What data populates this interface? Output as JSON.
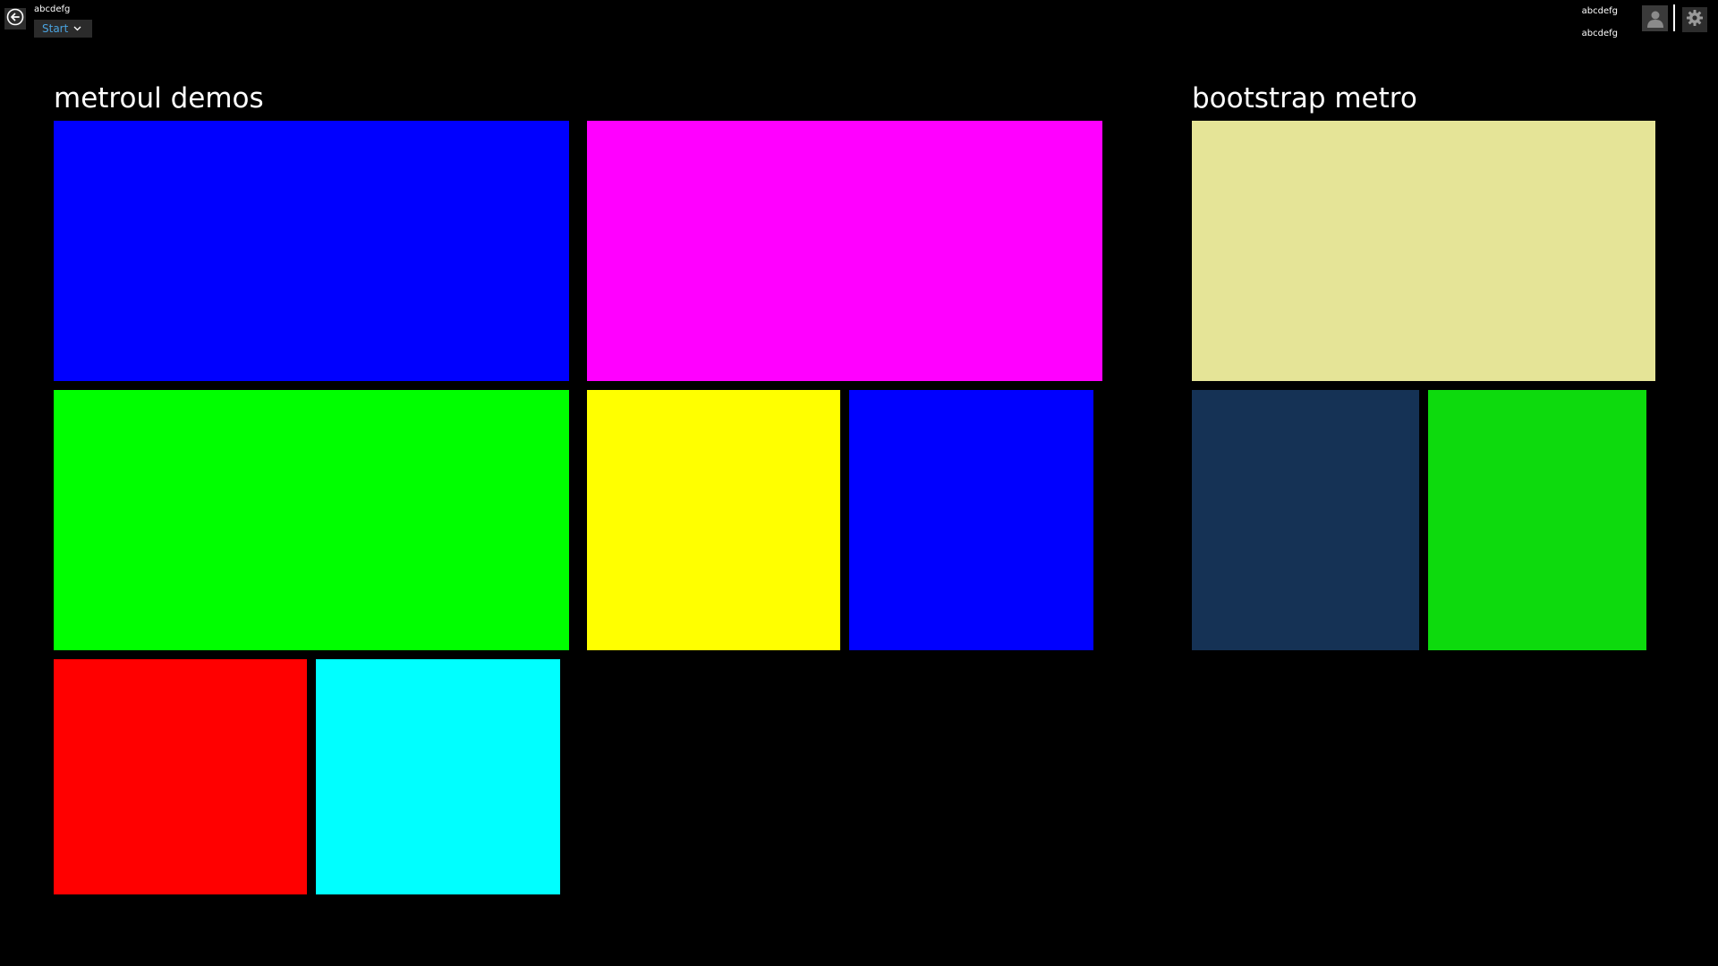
{
  "header": {
    "app_title": "abcdefg",
    "nav_selected": "Start",
    "user_first_name": "abcdefg",
    "user_last_name": "abcdefg"
  },
  "groups": [
    {
      "title": "metroul demos",
      "tiles": [
        {
          "color": "#0000FF"
        },
        {
          "color": "#FF00FF"
        },
        {
          "color": "#00FF00"
        },
        {
          "color": "#FFFF00"
        },
        {
          "color": "#0000FF"
        },
        {
          "color": "#FF0000"
        },
        {
          "color": "#00FFFF"
        }
      ]
    },
    {
      "title": "bootstrap metro",
      "tiles": [
        {
          "color": "#E5E497"
        },
        {
          "color": "#153255"
        },
        {
          "color": "#0DDA0D"
        }
      ]
    }
  ],
  "icons": {
    "back": "back-arrow-icon",
    "nav_chevron": "chevron-down-icon",
    "avatar": "user-icon",
    "settings": "gear-icon"
  }
}
